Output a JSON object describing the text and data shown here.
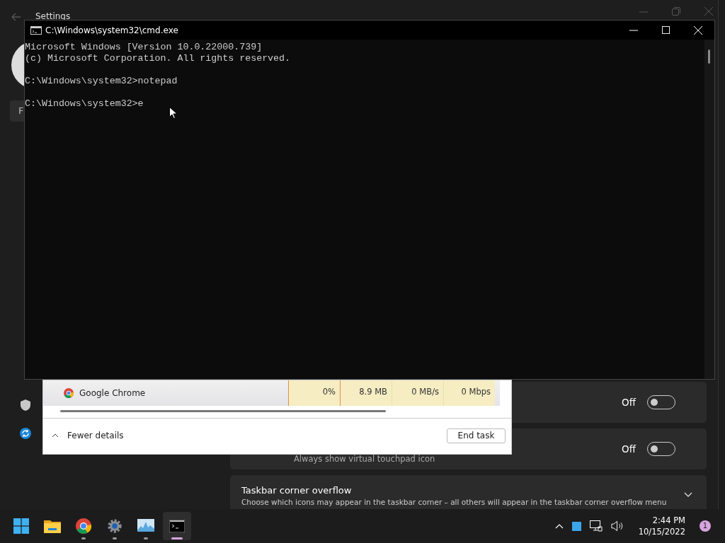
{
  "settings": {
    "title": "Settings",
    "search_placeholder": "F",
    "toggle_rows": [
      {
        "state_label": "Off",
        "on": false
      },
      {
        "description": "Always show virtual touchpad icon",
        "state_label": "Off",
        "on": false
      }
    ],
    "overflow": {
      "title": "Taskbar corner overflow",
      "description": "Choose which icons may appear in the taskbar corner – all others will appear in the taskbar corner overflow menu",
      "expanded": false
    }
  },
  "task_manager": {
    "rows": [
      {
        "name": "Google Chrome",
        "cpu": "0%",
        "memory": "8.9 MB",
        "disk": "0 MB/s",
        "network": "0 Mbps"
      }
    ],
    "fewer_details": "Fewer details",
    "end_task": "End task"
  },
  "cmd": {
    "title": "C:\\Windows\\system32\\cmd.exe",
    "blocks": [
      [
        "Microsoft Windows [Version 10.0.22000.739]",
        "(c) Microsoft Corporation. All rights reserved."
      ],
      [
        "C:\\Windows\\system32>notepad"
      ],
      [
        "C:\\Windows\\system32>e"
      ]
    ]
  },
  "taskbar": {
    "apps": [
      {
        "kind": "start",
        "running": false,
        "selected": false
      },
      {
        "kind": "folder",
        "running": false,
        "selected": false
      },
      {
        "kind": "chrome",
        "running": true,
        "selected": false
      },
      {
        "kind": "gear",
        "running": true,
        "selected": false
      },
      {
        "kind": "monitor",
        "running": true,
        "selected": false
      },
      {
        "kind": "terminal",
        "running": true,
        "selected": true
      }
    ],
    "time": "2:44 PM",
    "date": "10/15/2022",
    "notifications": "1"
  }
}
